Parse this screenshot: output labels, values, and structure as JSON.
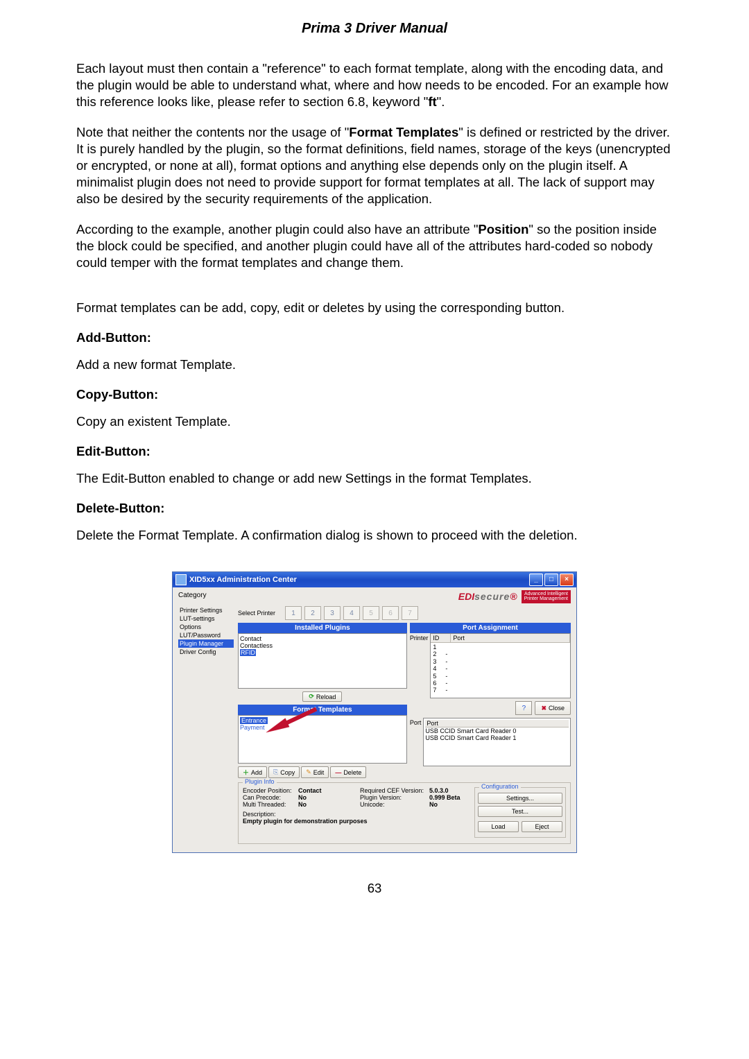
{
  "title": "Prima 3 Driver Manual",
  "page_number": "63",
  "paragraphs": {
    "p1a": "Each layout must then contain a \"reference\" to each format template, along with the encoding data, and the plugin would be able to understand what, where and how needs to be encoded. For an example how this reference looks like, please refer to section 6.8, keyword \"",
    "p1b": "ft",
    "p1c": "\".",
    "p2a": "Note that neither the contents nor the usage of \"",
    "p2b": "Format Templates",
    "p2c": "\" is defined or restricted by the driver. It is purely handled by the plugin, so the format definitions, field names, storage of the keys (unencrypted or encrypted, or none at all), format options and anything else depends only on the plugin itself. A minimalist plugin does not need to provide support for format templates at all. The lack of support may also be desired by the security requirements of the application.",
    "p3a": "According to the example, another plugin could also have an attribute \"",
    "p3b": "Position",
    "p3c": "\" so the position inside the block could be specified, and another plugin could have all of the attributes hard-coded so nobody could temper with the format templates and change them.",
    "p4": "Format templates can be add, copy, edit or deletes by using the corresponding button.",
    "add_h": "Add-Button:",
    "add_t": "Add a new format Template.",
    "copy_h": "Copy-Button:",
    "copy_t": "Copy an existent Template.",
    "edit_h": "Edit-Button:",
    "edit_t": "The Edit-Button enabled to change or add new Settings in the format Templates.",
    "del_h": "Delete-Button:",
    "del_t": "Delete the Format Template. A confirmation dialog is shown to proceed with the deletion."
  },
  "app": {
    "window_title": "XID5xx Administration Center",
    "brand_edi": "EDI",
    "brand_secure": "secure",
    "brand_star": "®",
    "brand_sub1": "Advanced Intelligent",
    "brand_sub2": "Printer Management",
    "category_label": "Category",
    "sidebar": {
      "i0": "Printer Settings",
      "i1": "LUT-settings",
      "i2": "Options",
      "i3": "LUT/Password",
      "i4": "Plugin Manager",
      "i5": "Driver Config"
    },
    "select_printer": "Select Printer",
    "tabs": {
      "t1": "1",
      "t2": "2",
      "t3": "3",
      "t4": "4",
      "t5": "5",
      "t6": "6",
      "t7": "7"
    },
    "installed_plugins_hdr": "Installed Plugins",
    "plugins": {
      "p0": "Contact",
      "p1": "Contactless",
      "p2": "RFID"
    },
    "reload": "Reload",
    "format_templates_hdr": "Format Templates",
    "ft_items": {
      "f0": "Entrance",
      "f1": "Payment"
    },
    "toolbar": {
      "add": "Add",
      "copy": "Copy",
      "edit": "Edit",
      "del": "Delete"
    },
    "port_assignment_hdr": "Port Assignment",
    "printer_lbl": "Printer",
    "port_tbl": {
      "id": "ID",
      "port": "Port",
      "r1": "1",
      "r2": "2",
      "r3": "3",
      "r4": "4",
      "r5": "5",
      "r6": "6",
      "r7": "7",
      "dash": "-"
    },
    "close_btn": "Close",
    "port_lbl": "Port",
    "port_hdr": "Port",
    "port_items": {
      "p0": "USB CCID Smart Card Reader 0",
      "p1": "USB CCID Smart Card Reader 1"
    },
    "plugin_info_legend": "Plugin Info",
    "pi": {
      "l1": "Encoder Position:",
      "v1": "Contact",
      "l2": "Can Precode:",
      "v2": "No",
      "l3": "Multi Threaded:",
      "v3": "No",
      "l4": "Required CEF Version:",
      "v4": "5.0.3.0",
      "l5": "Plugin Version:",
      "v5": "0.999 Beta",
      "l6": "Unicode:",
      "v6": "No",
      "dl": "Description:",
      "dv": "Empty plugin for demonstration purposes"
    },
    "cfg_legend": "Configuration",
    "cfg": {
      "settings": "Settings...",
      "test": "Test...",
      "load": "Load",
      "eject": "Eject"
    }
  }
}
